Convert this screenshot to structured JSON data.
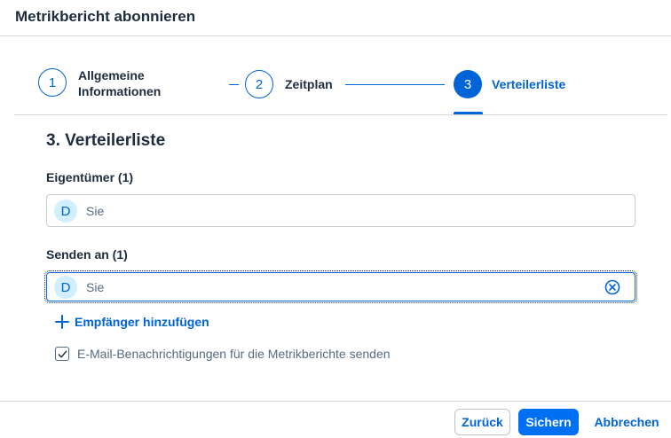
{
  "dialog": {
    "title": "Metrikbericht abonnieren"
  },
  "wizard": {
    "steps": [
      {
        "number": "1",
        "label": "Allgemeine Informationen",
        "label_line1": "Allgemeine",
        "label_line2": "Informationen",
        "state": "completed"
      },
      {
        "number": "2",
        "label": "Zeitplan",
        "state": "completed"
      },
      {
        "number": "3",
        "label": "Verteilerliste",
        "state": "active"
      }
    ]
  },
  "content": {
    "section_title": "3. Verteilerliste",
    "owner": {
      "label": "Eigentümer (1)",
      "tokens": [
        {
          "initial": "D",
          "text": "Sie"
        }
      ]
    },
    "send_to": {
      "label": "Senden an (1)",
      "tokens": [
        {
          "initial": "D",
          "text": "Sie"
        }
      ],
      "clear_icon": "clear-circle-icon"
    },
    "add_recipient": {
      "label": "Empfänger hinzufügen",
      "icon": "plus-icon"
    },
    "email_notifications": {
      "label": "E-Mail-Benachrichtigungen für die Metrikberichte senden",
      "checked": true
    }
  },
  "footer": {
    "back_label": "Zurück",
    "save_label": "Sichern",
    "cancel_label": "Abbrechen"
  },
  "colors": {
    "accent": "#0064d9",
    "primary_button": "#0070f2",
    "text": "#1d2d3e",
    "secondary_text": "#556b82"
  }
}
